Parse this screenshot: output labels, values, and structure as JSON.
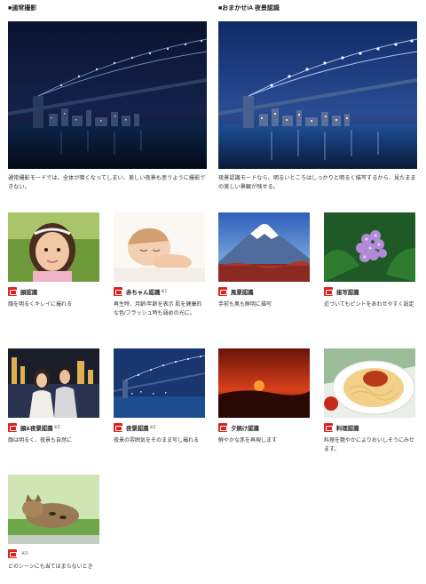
{
  "compare": {
    "left": {
      "title": "■通常撮影",
      "description": "通常撮影モードでは、全体が暗くなってしまい、美しい夜景も思うように撮影できない。"
    },
    "right": {
      "title": "■おまかせiA 夜景認識",
      "description": "夜景認識モードなら、明るいところはしっかりと明るく描写するから、見たままの美しい景観が残せる。"
    }
  },
  "scenes": [
    {
      "title": "顔認識",
      "note": "",
      "description": "顔を明るくキレイに撮れる",
      "icon": "face-mode-icon"
    },
    {
      "title": "赤ちゃん認識",
      "note": "※1",
      "description": "再生時、月齢/年齢を表示 肌を健康的な色/フラッシュ時も弱めの光に。",
      "icon": "baby-mode-icon"
    },
    {
      "title": "風景認識",
      "note": "",
      "description": "手前も奥も鮮明に描写",
      "icon": "scenery-mode-icon"
    },
    {
      "title": "接写認識",
      "note": "",
      "description": "近づいてもピントをあわせやすく設定",
      "icon": "macro-mode-icon"
    },
    {
      "title": "顔&夜景認識",
      "note": "※2",
      "description": "顔は明るく、夜景も自然に",
      "icon": "face-night-mode-icon"
    },
    {
      "title": "夜景認識",
      "note": "※2",
      "description": "夜景の雰囲気をそのまま写し撮れる",
      "icon": "night-mode-icon"
    },
    {
      "title": "夕焼け認識",
      "note": "",
      "description": "鮮やかな赤を再現します",
      "icon": "sunset-mode-icon"
    },
    {
      "title": "料理認識",
      "note": "",
      "description": "料理を艶やかによりおいしそうにみせます。",
      "icon": "food-mode-icon"
    },
    {
      "title": "",
      "note": "※3",
      "description": "どのシーンにも当てはまらないとき",
      "icon": "ia-mode-icon"
    }
  ],
  "colors": {
    "accent": "#d9231b",
    "night_sky": "#0b1a3a",
    "text": "#222222"
  }
}
